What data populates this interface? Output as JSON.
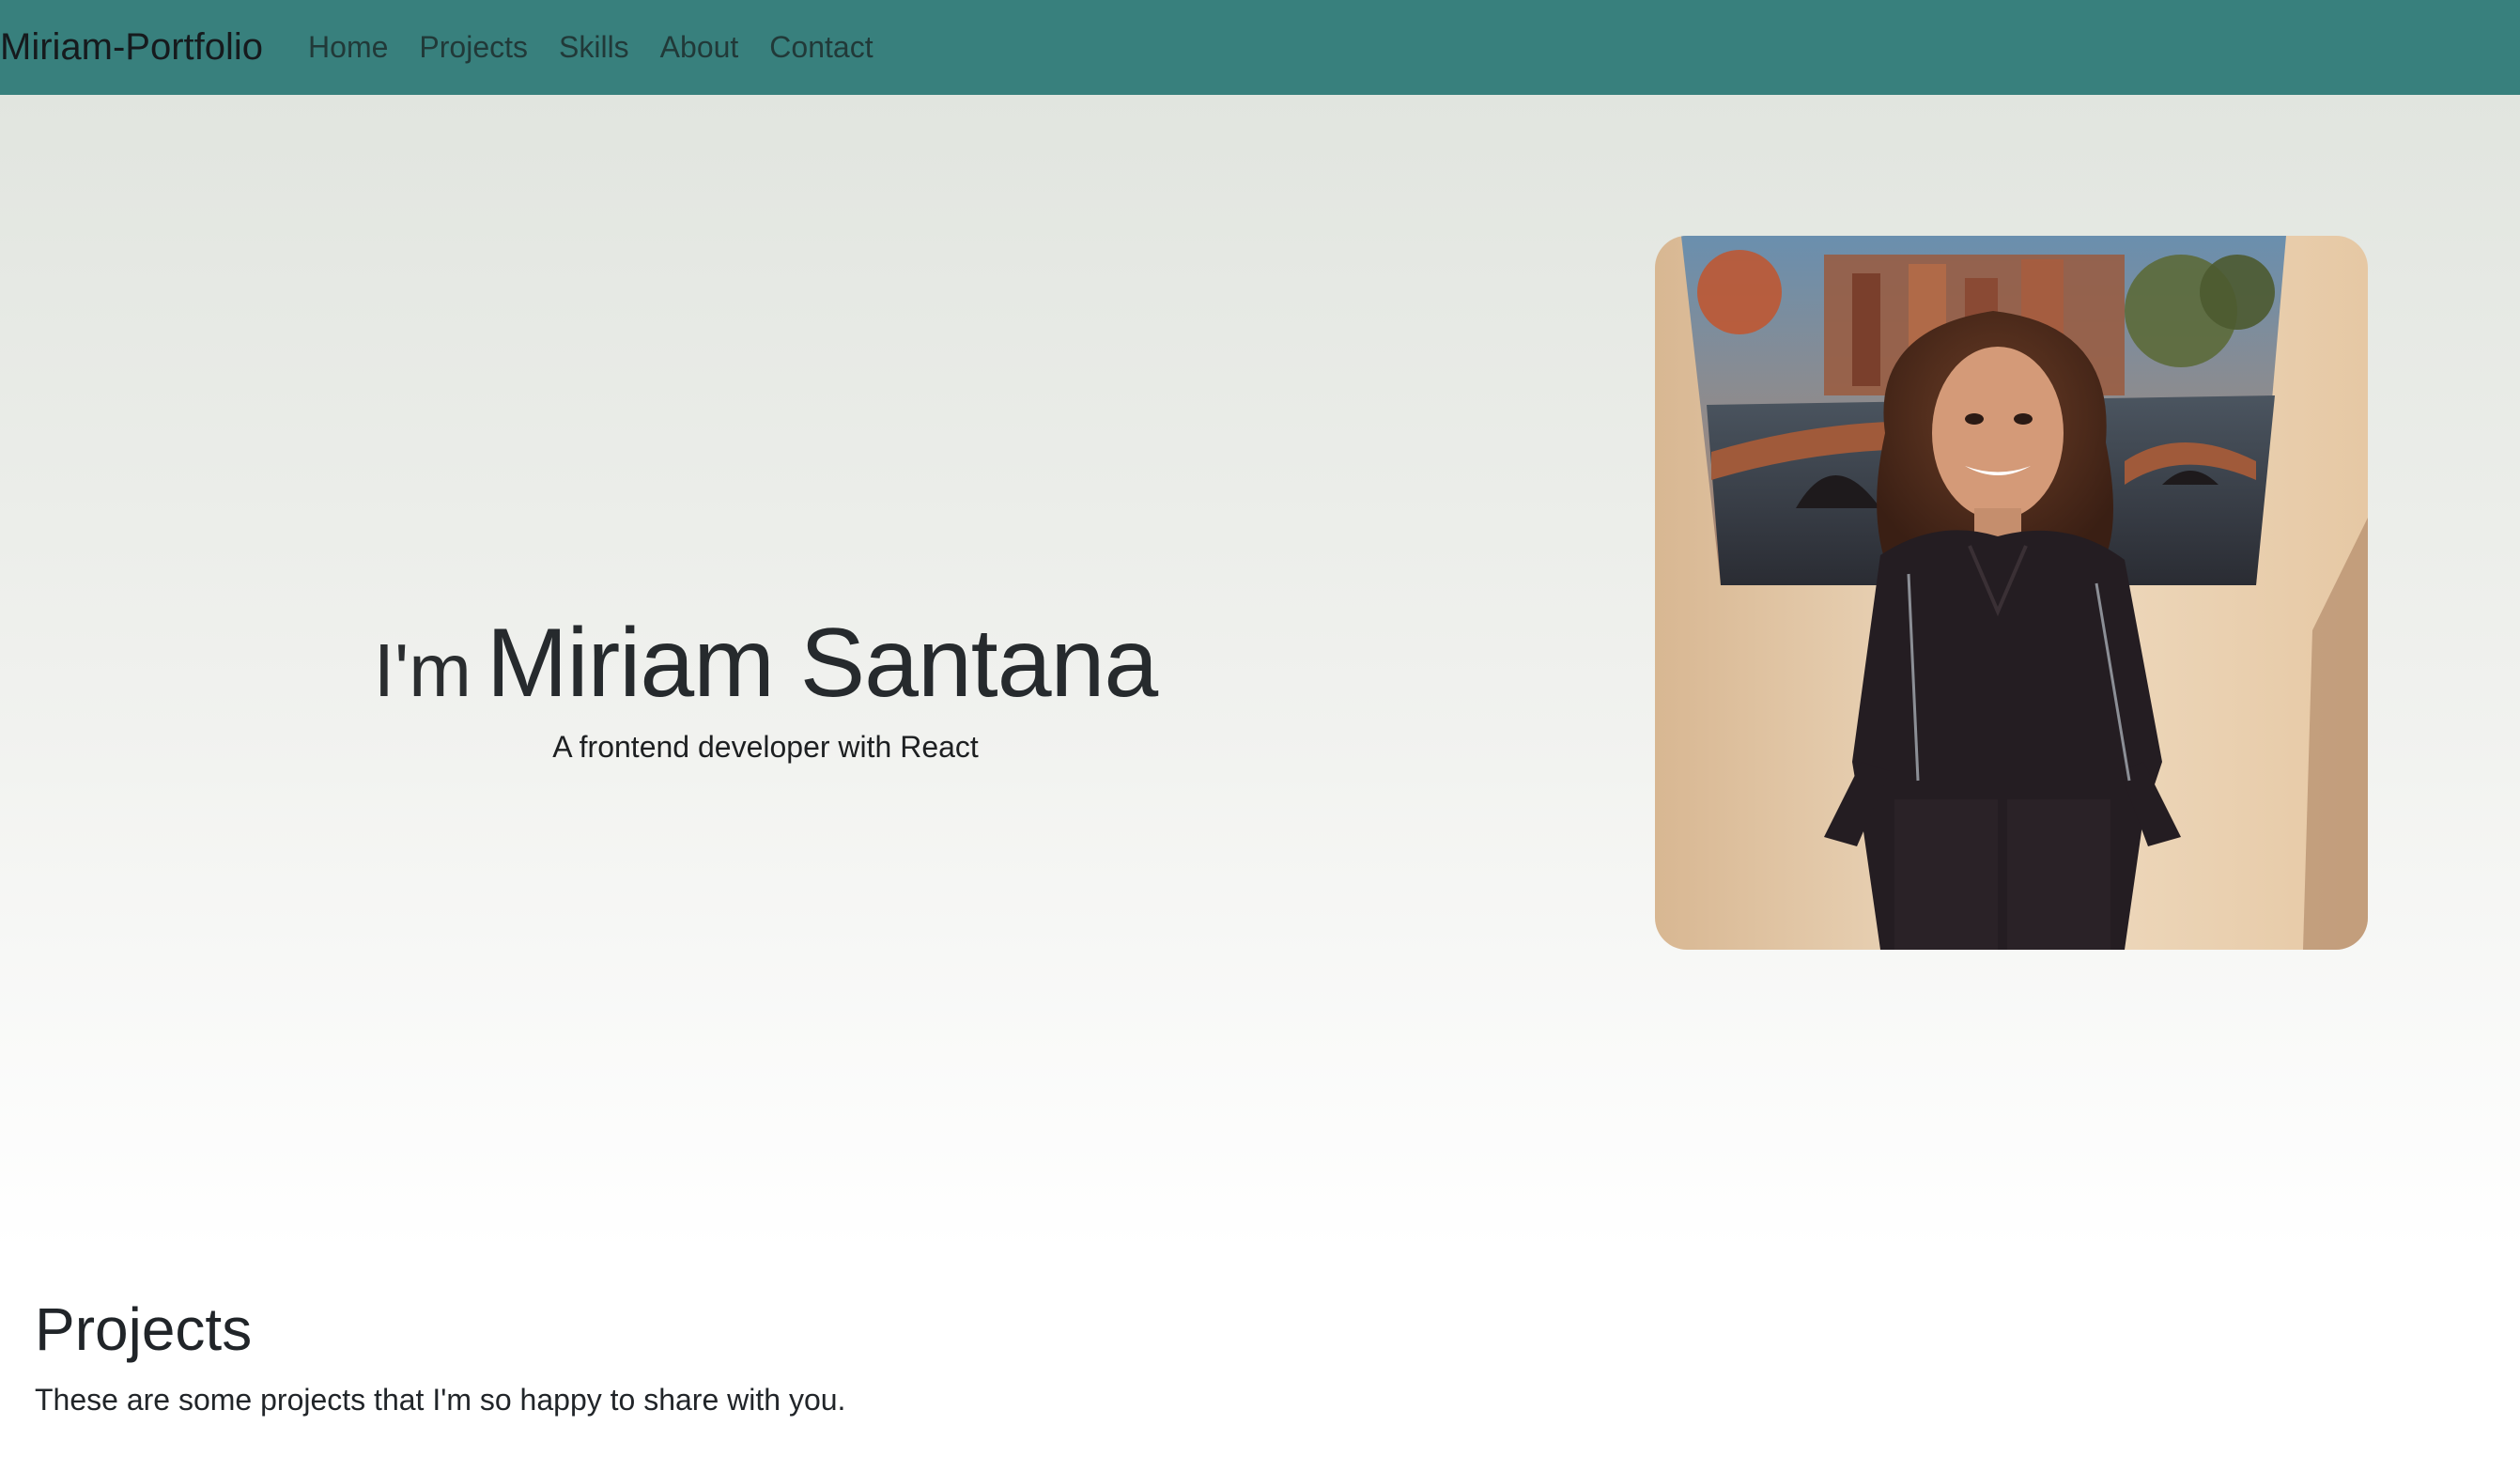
{
  "navbar": {
    "brand": "Miriam-Portfolio",
    "links": [
      "Home",
      "Projects",
      "Skills",
      "About",
      "Contact"
    ]
  },
  "hero": {
    "greeting": "I'm",
    "name": "Miriam Santana",
    "subtitle": "A frontend developer with React"
  },
  "projects": {
    "title": "Projects",
    "description": "These are some projects that I'm so happy to share with you."
  },
  "colors": {
    "navbar_background": "#38807d",
    "hero_gradient_top": "#e1e5df",
    "hero_gradient_bottom": "#ffffff",
    "text": "#212529"
  }
}
